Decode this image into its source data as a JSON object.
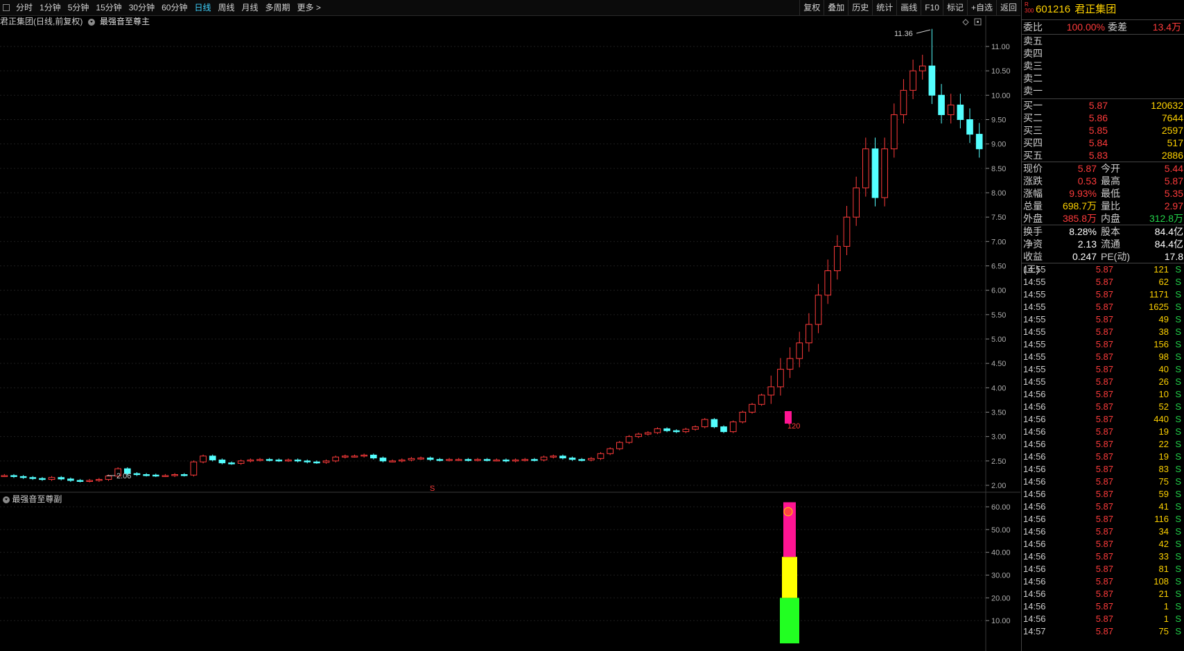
{
  "toolbar": {
    "periods": [
      "分时",
      "1分钟",
      "5分钟",
      "15分钟",
      "30分钟",
      "60分钟",
      "日线",
      "周线",
      "月线",
      "多周期",
      "更多 >"
    ],
    "active": "日线",
    "right": [
      "复权",
      "叠加",
      "历史",
      "统计",
      "画线",
      "F10",
      "标记",
      "+自选",
      "返回"
    ]
  },
  "chart": {
    "title": "君正集团(日线,前复权)",
    "indicator_main": "最强音至尊主",
    "indicator_sub": "最强音至尊副",
    "price_axis": [
      "11.00",
      "10.50",
      "10.00",
      "9.50",
      "9.00",
      "8.50",
      "8.00",
      "7.50",
      "7.00",
      "6.50",
      "6.00",
      "5.50",
      "5.00",
      "4.50",
      "4.00",
      "3.50",
      "3.00",
      "2.50",
      "2.00"
    ],
    "high_label": "11.36",
    "low_label": "2.06",
    "mark_label": "120",
    "s_label": "S",
    "sub_axis": [
      "60.00",
      "50.00",
      "40.00",
      "30.00",
      "20.00",
      "10.00"
    ],
    "colors": {
      "up": "#ff3b3b",
      "down": "#54ffff",
      "bg": "#000000"
    }
  },
  "chart_data": {
    "type": "candlestick",
    "ylim": [
      1.8,
      11.6
    ],
    "candles_sample": [
      {
        "o": 5.29,
        "c": 5.87,
        "h": 5.87,
        "l": 5.1
      },
      {
        "o": 6.37,
        "c": 6.12,
        "h": 6.55,
        "l": 6.05
      },
      {
        "o": 6.7,
        "c": 7.05,
        "h": 7.1,
        "l": 6.6
      }
    ],
    "sub_bars": [
      {
        "color": "#22ff22",
        "from": 0,
        "to": 20
      },
      {
        "color": "#ffff00",
        "from": 20,
        "to": 38
      },
      {
        "color": "#ff1493",
        "from": 38,
        "to": 62
      }
    ]
  },
  "quote": {
    "badge": "R\n300",
    "code": "601216",
    "name": "君正集团",
    "wb_label": "委比",
    "wb_value": "100.00%",
    "wc_label": "委差",
    "wc_value": "13.4万",
    "sells": [
      "卖五",
      "卖四",
      "卖三",
      "卖二",
      "卖一"
    ],
    "buys": [
      {
        "label": "买一",
        "price": "5.87",
        "vol": "120632"
      },
      {
        "label": "买二",
        "price": "5.86",
        "vol": "7644"
      },
      {
        "label": "买三",
        "price": "5.85",
        "vol": "2597"
      },
      {
        "label": "买四",
        "price": "5.84",
        "vol": "517"
      },
      {
        "label": "买五",
        "price": "5.83",
        "vol": "2886"
      }
    ],
    "stats": [
      {
        "l1": "现价",
        "v1": "5.87",
        "c1": "red",
        "l2": "今开",
        "v2": "5.44",
        "c2": "red"
      },
      {
        "l1": "涨跌",
        "v1": "0.53",
        "c1": "red",
        "l2": "最高",
        "v2": "5.87",
        "c2": "red"
      },
      {
        "l1": "涨幅",
        "v1": "9.93%",
        "c1": "red",
        "l2": "最低",
        "v2": "5.35",
        "c2": "red"
      },
      {
        "l1": "总量",
        "v1": "698.7万",
        "c1": "yel",
        "l2": "量比",
        "v2": "2.97",
        "c2": "red"
      },
      {
        "l1": "外盘",
        "v1": "385.8万",
        "c1": "red",
        "l2": "内盘",
        "v2": "312.8万",
        "c2": "grn"
      }
    ],
    "fund": [
      {
        "l1": "换手",
        "v1": "8.28%",
        "l2": "股本",
        "v2": "84.4亿"
      },
      {
        "l1": "净资",
        "v1": "2.13",
        "l2": "流通",
        "v2": "84.4亿"
      },
      {
        "l1": "收益(三)",
        "v1": "0.247",
        "l2": "PE(动)",
        "v2": "17.8"
      }
    ],
    "ticks": [
      {
        "t": "14:55",
        "p": "5.87",
        "v": "121",
        "s": "S",
        "c": "yel"
      },
      {
        "t": "14:55",
        "p": "5.87",
        "v": "62",
        "s": "S",
        "c": "yel"
      },
      {
        "t": "14:55",
        "p": "5.87",
        "v": "1171",
        "s": "S",
        "c": "mag"
      },
      {
        "t": "14:55",
        "p": "5.87",
        "v": "1625",
        "s": "S",
        "c": "mag"
      },
      {
        "t": "14:55",
        "p": "5.87",
        "v": "49",
        "s": "S",
        "c": "yel"
      },
      {
        "t": "14:55",
        "p": "5.87",
        "v": "38",
        "s": "S",
        "c": "yel"
      },
      {
        "t": "14:55",
        "p": "5.87",
        "v": "156",
        "s": "S",
        "c": "yel"
      },
      {
        "t": "14:55",
        "p": "5.87",
        "v": "98",
        "s": "S",
        "c": "yel"
      },
      {
        "t": "14:55",
        "p": "5.87",
        "v": "40",
        "s": "S",
        "c": "yel"
      },
      {
        "t": "14:55",
        "p": "5.87",
        "v": "26",
        "s": "S",
        "c": "yel"
      },
      {
        "t": "14:56",
        "p": "5.87",
        "v": "10",
        "s": "S",
        "c": "yel"
      },
      {
        "t": "14:56",
        "p": "5.87",
        "v": "52",
        "s": "S",
        "c": "yel"
      },
      {
        "t": "14:56",
        "p": "5.87",
        "v": "440",
        "s": "S",
        "c": "yel"
      },
      {
        "t": "14:56",
        "p": "5.87",
        "v": "19",
        "s": "S",
        "c": "yel"
      },
      {
        "t": "14:56",
        "p": "5.87",
        "v": "22",
        "s": "S",
        "c": "yel"
      },
      {
        "t": "14:56",
        "p": "5.87",
        "v": "19",
        "s": "S",
        "c": "yel"
      },
      {
        "t": "14:56",
        "p": "5.87",
        "v": "83",
        "s": "S",
        "c": "yel"
      },
      {
        "t": "14:56",
        "p": "5.87",
        "v": "75",
        "s": "S",
        "c": "yel"
      },
      {
        "t": "14:56",
        "p": "5.87",
        "v": "59",
        "s": "S",
        "c": "yel"
      },
      {
        "t": "14:56",
        "p": "5.87",
        "v": "41",
        "s": "S",
        "c": "yel"
      },
      {
        "t": "14:56",
        "p": "5.87",
        "v": "116",
        "s": "S",
        "c": "yel"
      },
      {
        "t": "14:56",
        "p": "5.87",
        "v": "34",
        "s": "S",
        "c": "yel"
      },
      {
        "t": "14:56",
        "p": "5.87",
        "v": "42",
        "s": "S",
        "c": "yel"
      },
      {
        "t": "14:56",
        "p": "5.87",
        "v": "33",
        "s": "S",
        "c": "yel"
      },
      {
        "t": "14:56",
        "p": "5.87",
        "v": "81",
        "s": "S",
        "c": "yel"
      },
      {
        "t": "14:56",
        "p": "5.87",
        "v": "108",
        "s": "S",
        "c": "yel"
      },
      {
        "t": "14:56",
        "p": "5.87",
        "v": "21",
        "s": "S",
        "c": "yel"
      },
      {
        "t": "14:56",
        "p": "5.87",
        "v": "1",
        "s": "S",
        "c": "yel"
      },
      {
        "t": "14:56",
        "p": "5.87",
        "v": "1",
        "s": "S",
        "c": "yel"
      },
      {
        "t": "14:57",
        "p": "5.87",
        "v": "75",
        "s": "S",
        "c": "yel"
      }
    ]
  }
}
